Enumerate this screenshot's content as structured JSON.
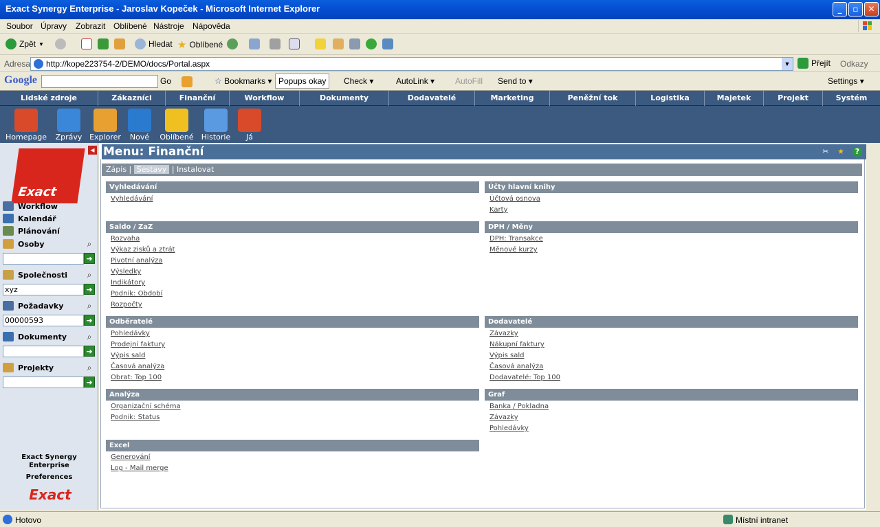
{
  "window": {
    "title": "Exact Synergy Enterprise - Jaroslav Kopeček - Microsoft Internet Explorer"
  },
  "menubar": [
    "Soubor",
    "Úpravy",
    "Zobrazit",
    "Oblíbené",
    "Nástroje",
    "Nápověda"
  ],
  "toolbar": {
    "back": "Zpět",
    "search": "Hledat",
    "favorites": "Oblíbené"
  },
  "address": {
    "label": "Adresa",
    "url": "http://kope223754-2/DEMO/docs/Portal.aspx",
    "go": "Přejít",
    "links": "Odkazy"
  },
  "googlebar": {
    "logo": "Google",
    "go": "Go",
    "bookmarks": "Bookmarks",
    "popups": "Popups okay",
    "check": "Check",
    "autolink": "AutoLink",
    "autofill": "AutoFill",
    "sendto": "Send to",
    "settings": "Settings"
  },
  "nav": [
    "Lidské zdroje",
    "Zákazníci",
    "Finanční",
    "Workflow",
    "Dokumenty",
    "Dodavatelé",
    "Marketing",
    "Peněžní tok",
    "Logistika",
    "Majetek",
    "Projekt",
    "Systém"
  ],
  "iconbar": [
    {
      "label": "Homepage",
      "icon": "home-icon",
      "color": "#d84a2a"
    },
    {
      "label": "Zprávy",
      "icon": "megaphone-icon",
      "color": "#3a86d8"
    },
    {
      "label": "Explorer",
      "icon": "folder-icon",
      "color": "#e8a030"
    },
    {
      "label": "Nové",
      "icon": "new-document-icon",
      "color": "#2a7ad0"
    },
    {
      "label": "Oblíbené",
      "icon": "star-icon",
      "color": "#f0c020"
    },
    {
      "label": "Historie",
      "icon": "history-icon",
      "color": "#5a9ae0"
    },
    {
      "label": "Já",
      "icon": "person-icon",
      "color": "#d84a2a"
    }
  ],
  "sidebar": {
    "logo": "Exact",
    "items": [
      {
        "label": "Workflow"
      },
      {
        "label": "Kalendář"
      },
      {
        "label": "Plánování"
      },
      {
        "label": "Osoby",
        "value": ""
      },
      {
        "label": "Společnosti",
        "value": "xyz"
      },
      {
        "label": "Požadavky",
        "value": "00000593"
      },
      {
        "label": "Dokumenty",
        "value": ""
      },
      {
        "label": "Projekty",
        "value": ""
      }
    ],
    "footer1": "Exact Synergy",
    "footer2": "Enterprise",
    "footer3": "Preferences",
    "footer_logo": "Exact"
  },
  "main": {
    "title": "Menu: Finanční",
    "tabs": {
      "t1": "Zápis",
      "t2": "Sestavy",
      "t3": "Instalovat"
    },
    "sections": [
      {
        "header": "Vyhledávání",
        "links": [
          "Vyhledávání"
        ]
      },
      {
        "header": "Účty hlavní knihy",
        "links": [
          "Účtová osnova",
          "Karty"
        ]
      },
      {
        "header": "Saldo / ZaZ",
        "links": [
          "Rozvaha",
          "Výkaz zisků a ztrát",
          "Pivotní analýza",
          "Výsledky",
          "Indikátory",
          "Podnik: Období",
          "Rozpočty"
        ]
      },
      {
        "header": "DPH / Měny",
        "links": [
          "DPH: Transakce",
          "Měnové kurzy"
        ]
      },
      {
        "header": "Odběratelé",
        "links": [
          "Pohledávky",
          "Prodejní faktury",
          "Výpis sald",
          "Časová analýza",
          "Obrat: Top 100"
        ]
      },
      {
        "header": "Dodavatelé",
        "links": [
          "Závazky",
          "Nákupní faktury",
          "Výpis sald",
          "Časová analýza",
          "Dodavatelé: Top 100"
        ]
      },
      {
        "header": "Analýza",
        "links": [
          "Organizační schéma",
          "Podnik: Status"
        ]
      },
      {
        "header": "Graf",
        "links": [
          "Banka / Pokladna",
          "Závazky",
          "Pohledávky"
        ]
      },
      {
        "header": "Excel",
        "links": [
          "Generování",
          "Log - Mail merge"
        ]
      }
    ]
  },
  "status": {
    "text": "Hotovo",
    "zone": "Místní intranet"
  }
}
